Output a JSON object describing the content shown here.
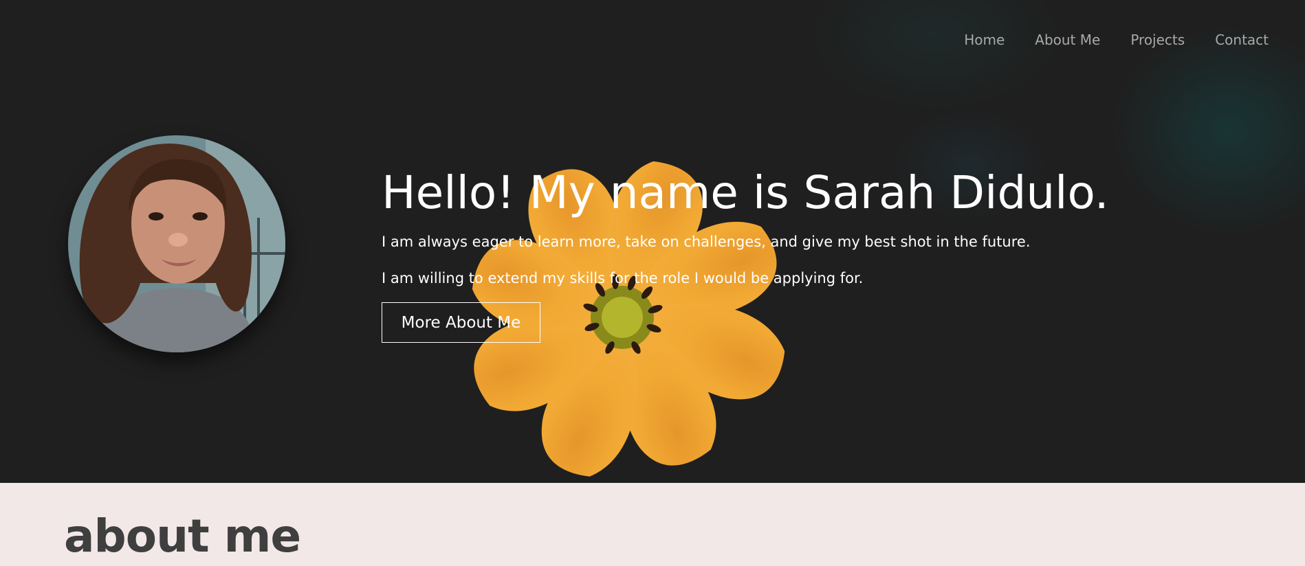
{
  "nav": {
    "items": [
      {
        "label": "Home"
      },
      {
        "label": "About Me"
      },
      {
        "label": "Projects"
      },
      {
        "label": "Contact"
      }
    ]
  },
  "hero": {
    "title": "Hello! My name is Sarah Didulo.",
    "line1": "I am always eager to learn more, take on challenges, and give my best shot in the future.",
    "line2": "I am willing to extend my skills for the role I would be applying for.",
    "button_label": "More About Me"
  },
  "about": {
    "title": "about me"
  },
  "colors": {
    "hero_background": "#1f1f1f",
    "about_background": "#f2e8e7",
    "nav_text": "#a9a9a9",
    "flower_petal": "#f0a531",
    "heading_dark": "#3f3f3f"
  }
}
